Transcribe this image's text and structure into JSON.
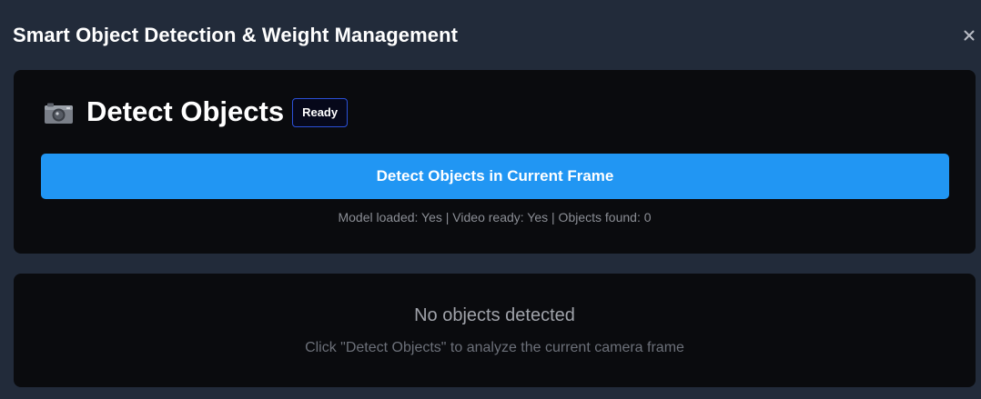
{
  "header": {
    "title": "Smart Object Detection & Weight Management",
    "close_icon": "close-icon"
  },
  "detect_panel": {
    "icon": "camera-icon",
    "title": "Detect Objects",
    "status_badge": "Ready",
    "button_label": "Detect Objects in Current Frame",
    "status_line": "Model loaded: Yes | Video ready: Yes | Objects found: 0"
  },
  "results_panel": {
    "empty_title": "No objects detected",
    "empty_subtitle": "Click \"Detect Objects\" to analyze the current camera frame"
  },
  "colors": {
    "background": "#222b3a",
    "panel": "#0a0b0e",
    "accent": "#2196f3",
    "badge_border": "#2b50d8"
  }
}
